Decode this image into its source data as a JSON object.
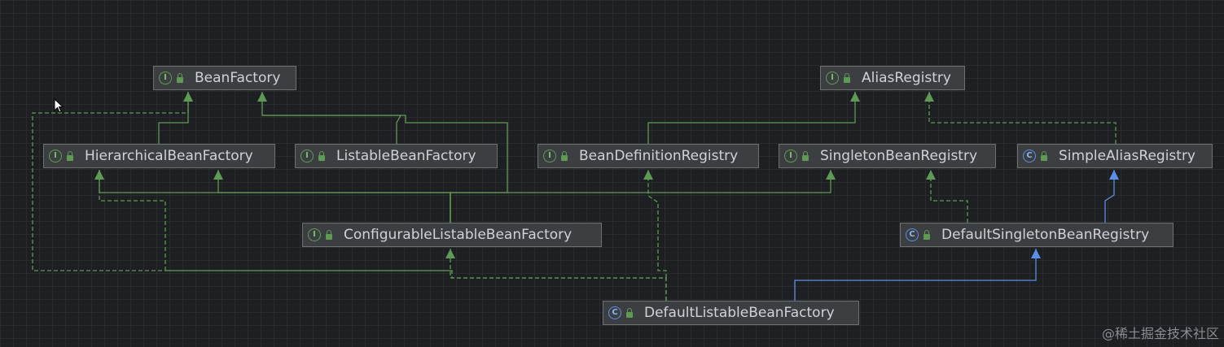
{
  "diagram": {
    "nodes": [
      {
        "id": "BeanFactory",
        "label": "BeanFactory",
        "kind": "I"
      },
      {
        "id": "AliasRegistry",
        "label": "AliasRegistry",
        "kind": "I"
      },
      {
        "id": "HierarchicalBeanFactory",
        "label": "HierarchicalBeanFactory",
        "kind": "I"
      },
      {
        "id": "ListableBeanFactory",
        "label": "ListableBeanFactory",
        "kind": "I"
      },
      {
        "id": "BeanDefinitionRegistry",
        "label": "BeanDefinitionRegistry",
        "kind": "I"
      },
      {
        "id": "SingletonBeanRegistry",
        "label": "SingletonBeanRegistry",
        "kind": "I"
      },
      {
        "id": "SimpleAliasRegistry",
        "label": "SimpleAliasRegistry",
        "kind": "C"
      },
      {
        "id": "ConfigurableListableBeanFactory",
        "label": "ConfigurableListableBeanFactory",
        "kind": "I"
      },
      {
        "id": "DefaultSingletonBeanRegistry",
        "label": "DefaultSingletonBeanRegistry",
        "kind": "C"
      },
      {
        "id": "DefaultListableBeanFactory",
        "label": "DefaultListableBeanFactory",
        "kind": "C"
      }
    ],
    "edges": [
      {
        "from": "HierarchicalBeanFactory",
        "to": "BeanFactory",
        "type": "extends"
      },
      {
        "from": "ListableBeanFactory",
        "to": "BeanFactory",
        "type": "extends"
      },
      {
        "from": "ConfigurableListableBeanFactory",
        "to": "BeanFactory",
        "type": "extends"
      },
      {
        "from": "BeanDefinitionRegistry",
        "to": "AliasRegistry",
        "type": "extends"
      },
      {
        "from": "SimpleAliasRegistry",
        "to": "AliasRegistry",
        "type": "implements"
      },
      {
        "from": "ConfigurableListableBeanFactory",
        "to": "HierarchicalBeanFactory",
        "type": "extends"
      },
      {
        "from": "ConfigurableListableBeanFactory",
        "to": "ListableBeanFactory",
        "type": "extends"
      },
      {
        "from": "ConfigurableListableBeanFactory",
        "to": "SingletonBeanRegistry",
        "type": "extends"
      },
      {
        "from": "DefaultSingletonBeanRegistry",
        "to": "SingletonBeanRegistry",
        "type": "implements"
      },
      {
        "from": "DefaultSingletonBeanRegistry",
        "to": "SimpleAliasRegistry",
        "type": "class-extends"
      },
      {
        "from": "DefaultListableBeanFactory",
        "to": "ConfigurableListableBeanFactory",
        "type": "implements"
      },
      {
        "from": "DefaultListableBeanFactory",
        "to": "BeanFactory",
        "type": "implements"
      },
      {
        "from": "DefaultListableBeanFactory",
        "to": "BeanDefinitionRegistry",
        "type": "implements"
      },
      {
        "from": "DefaultListableBeanFactory",
        "to": "HierarchicalBeanFactory",
        "type": "implements"
      },
      {
        "from": "DefaultListableBeanFactory",
        "to": "DefaultSingletonBeanRegistry",
        "type": "class-extends"
      }
    ],
    "colors": {
      "extends": "#5f9a55",
      "implements": "#5f9a55",
      "class-extends": "#5b8ee6"
    }
  },
  "watermark": "@稀土掘金技术社区"
}
